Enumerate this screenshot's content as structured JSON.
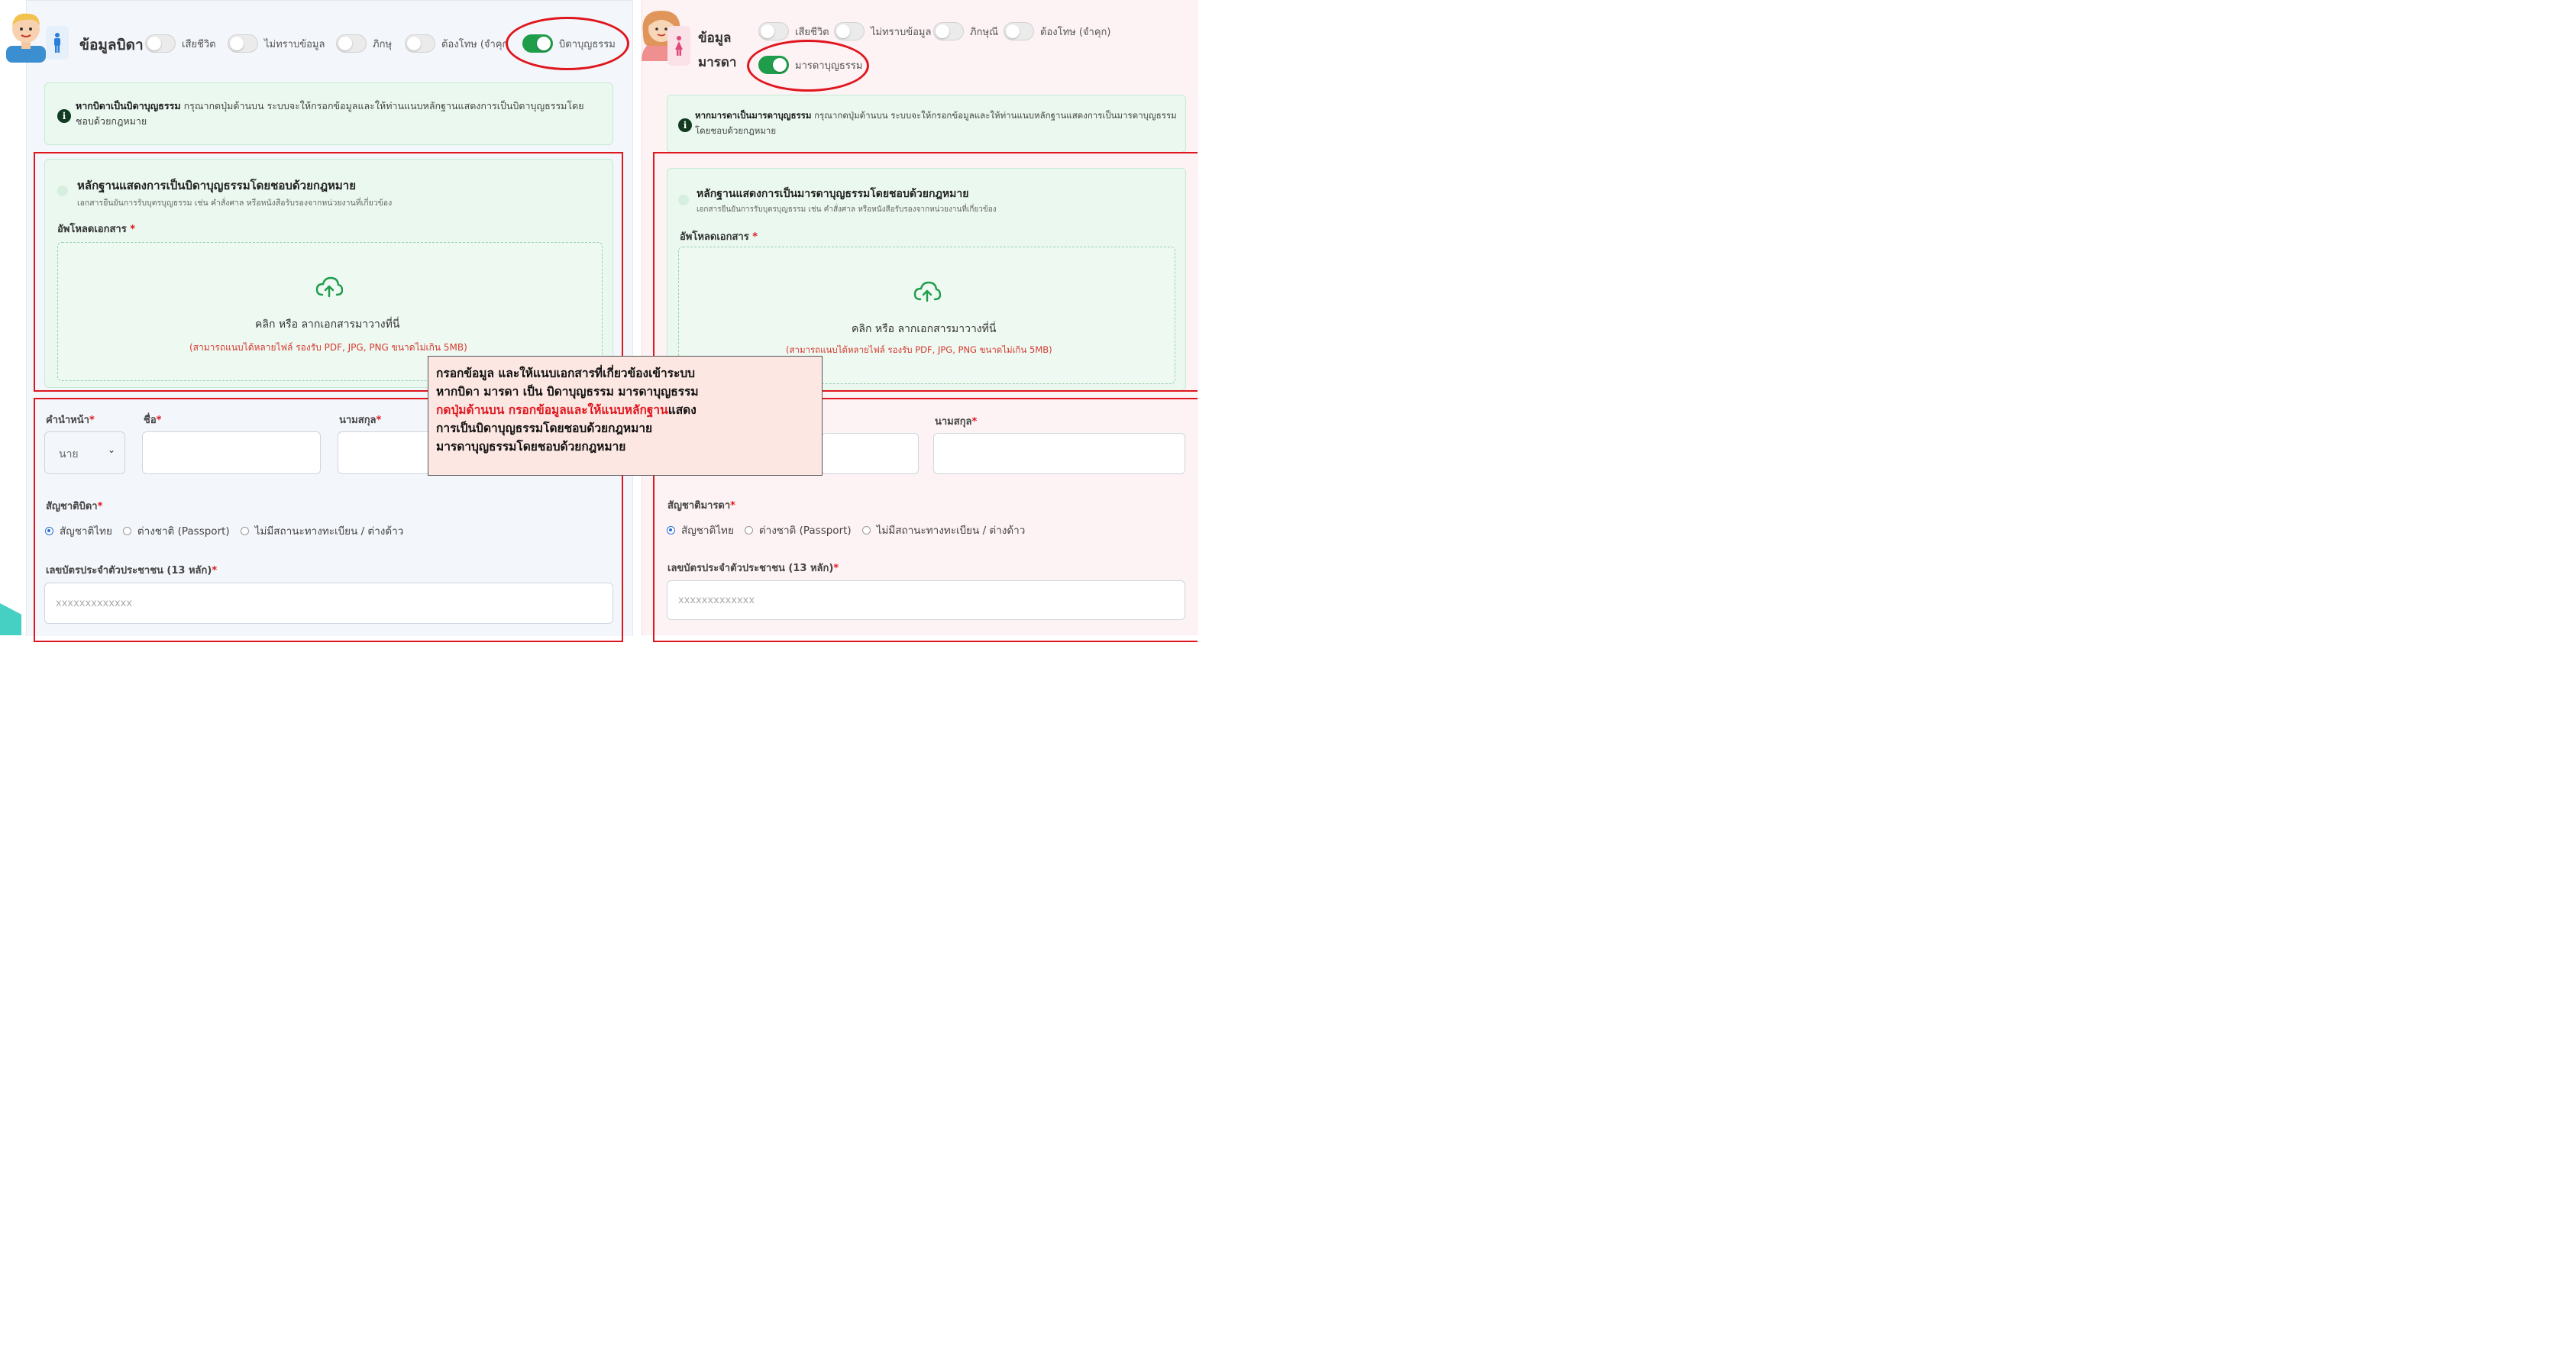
{
  "father": {
    "title": "ข้อมูลบิดา",
    "toggles": [
      {
        "label": "เสียชีวิต",
        "on": false
      },
      {
        "label": "ไม่ทราบข้อมูล",
        "on": false
      },
      {
        "label": "ภิกษุ",
        "on": false
      },
      {
        "label": "ต้องโทษ (จำคุก",
        "on": false
      },
      {
        "label": "บิดาบุญธรรม",
        "on": true
      }
    ],
    "info_bold": "หากบิดาเป็นบิดาบุญธรรม",
    "info_line1": " กรุณากดปุ่มด้านบน ระบบจะให้กรอกข้อมูลและให้ท่านแนบหลักฐานแสดงการเป็นบิดาบุญธรรมโดย",
    "info_line2": "ชอบด้วยกฎหมาย",
    "evidence_title": "หลักฐานแสดงการเป็นบิดาบุญธรรมโดยชอบด้วยกฎหมาย",
    "evidence_subtitle": "เอกสารยืนยันการรับบุตรบุญธรรม เช่น คำสั่งศาล หรือหนังสือรับรองจากหน่วยงานที่เกี่ยวข้อง",
    "upload_label": "อัพโหลดเอกสาร",
    "dropzone_main": "คลิก หรือ ลากเอกสารมาวางที่นี่",
    "dropzone_hint": "(สามารถแนบได้หลายไฟล์ รองรับ PDF, JPG, PNG ขนาดไม่เกิน 5MB)",
    "prefix_label": "คำนำหน้า",
    "prefix_value": "นาย",
    "firstname_label": "ชื่อ",
    "lastname_label": "นามสกุล",
    "nationality_label": "สัญชาติบิดา",
    "nationality_options": [
      "สัญชาติไทย",
      "ต่างชาติ (Passport)",
      "ไม่มีสถานะทางทะเบียน / ต่างด้าว"
    ],
    "nationality_selected": 0,
    "id_label": "เลขบัตรประจำตัวประชาชน (13 หลัก)",
    "id_placeholder": "xxxxxxxxxxxxx"
  },
  "mother": {
    "title_line1": "ข้อมูล",
    "title_line2": "มารดา",
    "toggles": [
      {
        "label": "เสียชีวิต",
        "on": false
      },
      {
        "label": "ไม่ทราบข้อมูล",
        "on": false
      },
      {
        "label": "ภิกษุณี",
        "on": false
      },
      {
        "label": "ต้องโทษ (จำคุก)",
        "on": false
      },
      {
        "label": "มารดาบุญธรรม",
        "on": true
      }
    ],
    "info_bold": "หากมารดาเป็นมารดาบุญธรรม",
    "info_line1": " กรุณากดปุ่มด้านบน ระบบจะให้กรอกข้อมูลและให้ท่านแนบหลักฐานแสดงการเป็นมารดาบุญธรรม",
    "info_line2": "โดยชอบด้วยกฎหมาย",
    "evidence_title": "หลักฐานแสดงการเป็นมารดาบุญธรรมโดยชอบด้วยกฎหมาย",
    "evidence_subtitle": "เอกสารยืนยันการรับบุตรบุญธรรม เช่น คำสั่งศาล หรือหนังสือรับรองจากหน่วยงานที่เกี่ยวข้อง",
    "upload_label": "อัพโหลดเอกสาร",
    "dropzone_main": "คลิก หรือ ลากเอกสารมาวางที่นี่",
    "dropzone_hint": "(สามารถแนบได้หลายไฟล์ รองรับ PDF, JPG, PNG ขนาดไม่เกิน 5MB)",
    "lastname_label": "นามสกุล",
    "nationality_label": "สัญชาติมารดา",
    "nationality_options": [
      "สัญชาติไทย",
      "ต่างชาติ (Passport)",
      "ไม่มีสถานะทางทะเบียน / ต่างด้าว"
    ],
    "nationality_selected": 0,
    "id_label": "เลขบัตรประจำตัวประชาชน (13 หลัก)",
    "id_placeholder": "xxxxxxxxxxxxx"
  },
  "required_mark": "*",
  "annotation": {
    "line1": "กรอกข้อมูล และให้แนบเอกสารที่เกี่ยวข้องเข้าระบบ",
    "line2": "หากบิดา มารดา เป็น บิดาบุญธรรม มารดาบุญธรรม",
    "line3_highlight": "กดปุ่มด้านบน กรอกข้อมูลและให้แนบหลักฐาน",
    "line3_rest": "แสดง",
    "line4": "การเป็นบิดาบุญธรรมโดยชอบด้วยกฎหมาย",
    "line5": "มารดาบุญธรรมโดยชอบด้วยกฎหมาย"
  },
  "colors": {
    "toggle_on": "#1f9d4a",
    "highlight_red": "#e0161e",
    "info_bg": "#eaf8ef",
    "annotation_bg": "#fce7e2"
  },
  "icons": {
    "father_avatar": "male-avatar-icon",
    "mother_avatar": "female-avatar-icon",
    "info": "info-icon",
    "upload": "cloud-upload-icon",
    "select": "chevron-down-icon"
  }
}
